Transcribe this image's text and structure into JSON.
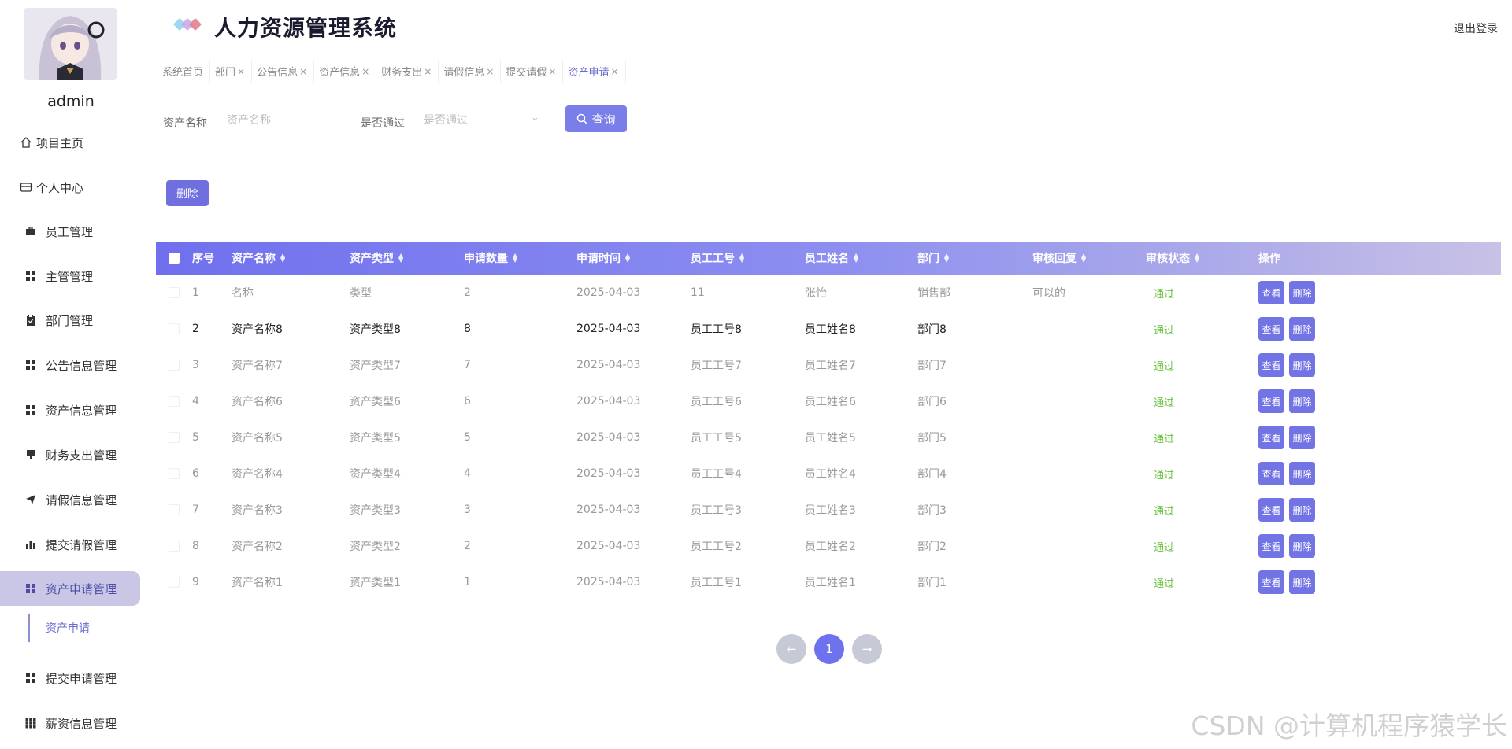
{
  "user": {
    "name": "admin"
  },
  "app": {
    "title": "人力资源管理系统",
    "logout": "退出登录"
  },
  "sidebar": {
    "items": [
      {
        "label": "项目主页",
        "icon": "home-icon"
      },
      {
        "label": "个人中心",
        "icon": "card-icon"
      },
      {
        "label": "员工管理",
        "icon": "briefcase-icon"
      },
      {
        "label": "主管管理",
        "icon": "grid-icon"
      },
      {
        "label": "部门管理",
        "icon": "clipboard-icon"
      },
      {
        "label": "公告信息管理",
        "icon": "grid-icon"
      },
      {
        "label": "资产信息管理",
        "icon": "grid-icon"
      },
      {
        "label": "财务支出管理",
        "icon": "pin-icon"
      },
      {
        "label": "请假信息管理",
        "icon": "send-icon"
      },
      {
        "label": "提交请假管理",
        "icon": "bar-chart-icon"
      },
      {
        "label": "资产申请管理",
        "icon": "grid-icon"
      },
      {
        "label": "提交申请管理",
        "icon": "grid-icon"
      },
      {
        "label": "薪资信息管理",
        "icon": "grid9-icon"
      }
    ],
    "active_sub": "资产申请"
  },
  "tabs": [
    {
      "label": "系统首页",
      "closable": false
    },
    {
      "label": "部门",
      "closable": true
    },
    {
      "label": "公告信息",
      "closable": true
    },
    {
      "label": "资产信息",
      "closable": true
    },
    {
      "label": "财务支出",
      "closable": true
    },
    {
      "label": "请假信息",
      "closable": true
    },
    {
      "label": "提交请假",
      "closable": true
    },
    {
      "label": "资产申请",
      "closable": true,
      "current": true
    }
  ],
  "search": {
    "asset_name_label": "资产名称",
    "asset_name_placeholder": "资产名称",
    "passed_label": "是否通过",
    "passed_placeholder": "是否通过",
    "query_button": "查询"
  },
  "toolbar": {
    "delete_button": "删除"
  },
  "table": {
    "headers": [
      "序号",
      "资产名称",
      "资产类型",
      "申请数量",
      "申请时间",
      "员工工号",
      "员工姓名",
      "部门",
      "审核回复",
      "审核状态",
      "操作"
    ],
    "rows": [
      {
        "no": "1",
        "name": "名称",
        "type": "类型",
        "qty": "2",
        "time": "2025-04-03",
        "eno": "11",
        "ename": "张怡",
        "dept": "销售部",
        "reply": "可以的",
        "status": "通过"
      },
      {
        "no": "2",
        "name": "资产名称8",
        "type": "资产类型8",
        "qty": "8",
        "time": "2025-04-03",
        "eno": "员工工号8",
        "ename": "员工姓名8",
        "dept": "部门8",
        "reply": "",
        "status": "通过"
      },
      {
        "no": "3",
        "name": "资产名称7",
        "type": "资产类型7",
        "qty": "7",
        "time": "2025-04-03",
        "eno": "员工工号7",
        "ename": "员工姓名7",
        "dept": "部门7",
        "reply": "",
        "status": "通过"
      },
      {
        "no": "4",
        "name": "资产名称6",
        "type": "资产类型6",
        "qty": "6",
        "time": "2025-04-03",
        "eno": "员工工号6",
        "ename": "员工姓名6",
        "dept": "部门6",
        "reply": "",
        "status": "通过"
      },
      {
        "no": "5",
        "name": "资产名称5",
        "type": "资产类型5",
        "qty": "5",
        "time": "2025-04-03",
        "eno": "员工工号5",
        "ename": "员工姓名5",
        "dept": "部门5",
        "reply": "",
        "status": "通过"
      },
      {
        "no": "6",
        "name": "资产名称4",
        "type": "资产类型4",
        "qty": "4",
        "time": "2025-04-03",
        "eno": "员工工号4",
        "ename": "员工姓名4",
        "dept": "部门4",
        "reply": "",
        "status": "通过"
      },
      {
        "no": "7",
        "name": "资产名称3",
        "type": "资产类型3",
        "qty": "3",
        "time": "2025-04-03",
        "eno": "员工工号3",
        "ename": "员工姓名3",
        "dept": "部门3",
        "reply": "",
        "status": "通过"
      },
      {
        "no": "8",
        "name": "资产名称2",
        "type": "资产类型2",
        "qty": "2",
        "time": "2025-04-03",
        "eno": "员工工号2",
        "ename": "员工姓名2",
        "dept": "部门2",
        "reply": "",
        "status": "通过"
      },
      {
        "no": "9",
        "name": "资产名称1",
        "type": "资产类型1",
        "qty": "1",
        "time": "2025-04-03",
        "eno": "员工工号1",
        "ename": "员工姓名1",
        "dept": "部门1",
        "reply": "",
        "status": "通过"
      }
    ],
    "view_button": "查看",
    "delete_button": "删除"
  },
  "pagination": {
    "prev": "←",
    "current": "1",
    "next": "→"
  },
  "watermark": "CSDN @计算机程序猿学长",
  "colors": {
    "primary": "#6f72ee",
    "pass": "#67c23a",
    "active_bg": "#c9c6e6"
  }
}
